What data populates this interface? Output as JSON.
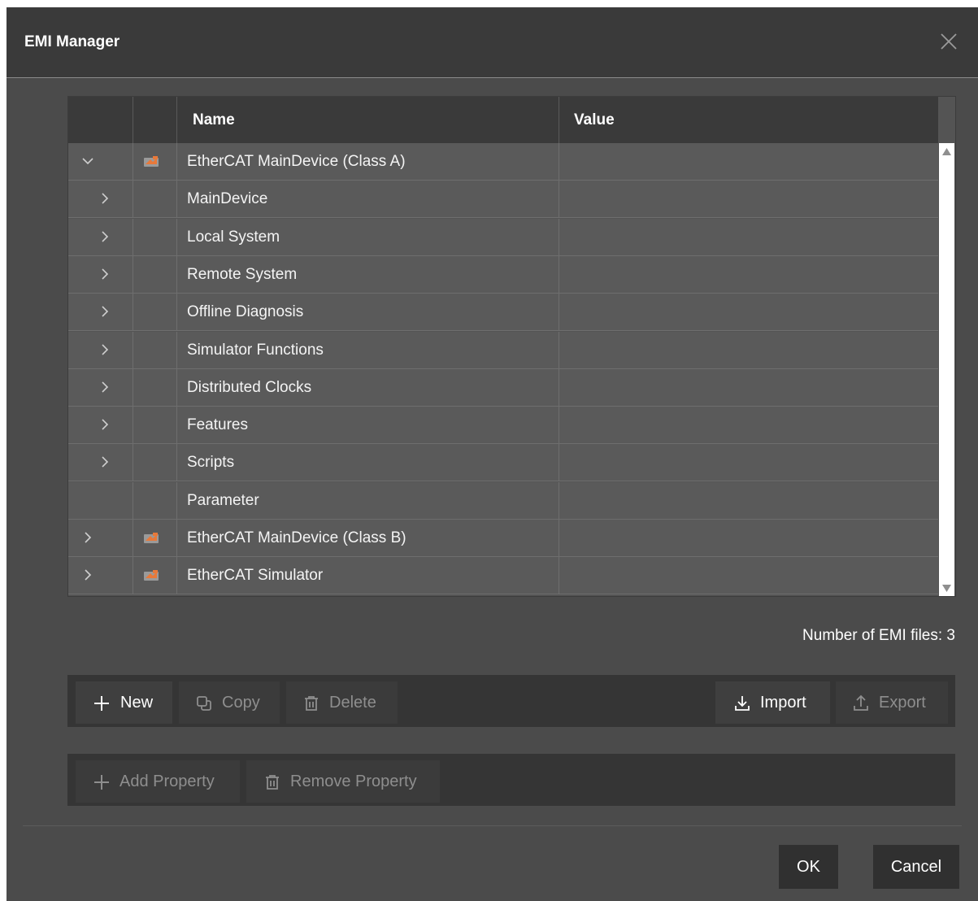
{
  "dialog": {
    "title": "EMI Manager",
    "close_icon": "close-icon"
  },
  "grid": {
    "columns": [
      "",
      "",
      "Name",
      "Value"
    ],
    "rows": [
      {
        "expander": "chevron-down",
        "level": 0,
        "icon": "ethercat-device-icon",
        "name": "EtherCAT MainDevice (Class A)",
        "value": ""
      },
      {
        "expander": "chevron-right",
        "level": 1,
        "icon": "",
        "name": "MainDevice",
        "value": ""
      },
      {
        "expander": "chevron-right",
        "level": 1,
        "icon": "",
        "name": "Local System",
        "value": ""
      },
      {
        "expander": "chevron-right",
        "level": 1,
        "icon": "",
        "name": "Remote System",
        "value": ""
      },
      {
        "expander": "chevron-right",
        "level": 1,
        "icon": "",
        "name": "Offline Diagnosis",
        "value": ""
      },
      {
        "expander": "chevron-right",
        "level": 1,
        "icon": "",
        "name": "Simulator Functions",
        "value": ""
      },
      {
        "expander": "chevron-right",
        "level": 1,
        "icon": "",
        "name": "Distributed Clocks",
        "value": ""
      },
      {
        "expander": "chevron-right",
        "level": 1,
        "icon": "",
        "name": "Features",
        "value": ""
      },
      {
        "expander": "chevron-right",
        "level": 1,
        "icon": "",
        "name": "Scripts",
        "value": ""
      },
      {
        "expander": "",
        "level": 1,
        "icon": "",
        "name": "Parameter",
        "value": ""
      },
      {
        "expander": "chevron-right",
        "level": 0,
        "icon": "ethercat-device-icon",
        "name": "EtherCAT MainDevice (Class B)",
        "value": ""
      },
      {
        "expander": "chevron-right",
        "level": 0,
        "icon": "ethercat-device-icon",
        "name": "EtherCAT Simulator",
        "value": ""
      }
    ]
  },
  "status": {
    "emi_count": "Number of EMI files: 3"
  },
  "file_toolbar": {
    "new_label": "New",
    "copy_label": "Copy",
    "delete_label": "Delete",
    "import_label": "Import",
    "export_label": "Export"
  },
  "property_toolbar": {
    "add_label": "Add Property",
    "remove_label": "Remove Property"
  },
  "footer": {
    "ok_label": "OK",
    "cancel_label": "Cancel"
  },
  "colors": {
    "dialog_bg": "#4b4b4b",
    "header_bg": "#3a3a3a",
    "row_bg": "#5a5a5a",
    "icon_accent": "#e8793a"
  }
}
